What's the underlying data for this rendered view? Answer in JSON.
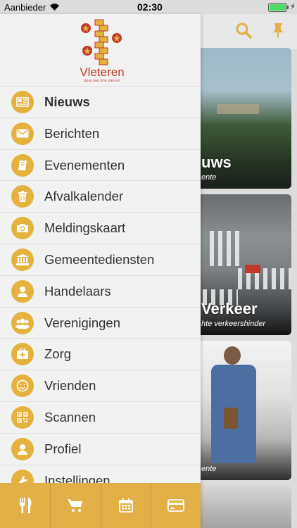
{
  "status_bar": {
    "carrier": "Aanbieder",
    "time": "02:30",
    "charge_symbol": "⚡"
  },
  "background": {
    "cards": [
      {
        "title": "uws",
        "subtitle": "ente"
      },
      {
        "title": "Verkeer",
        "subtitle": "hte verkeershinder"
      },
      {
        "title": "",
        "subtitle": "ente"
      }
    ]
  },
  "logo": {
    "wordmark": "Vleteren",
    "tagline": "dorp met drie sterren"
  },
  "menu": {
    "items": [
      {
        "label": "Nieuws",
        "icon": "newspaper-icon",
        "active": true
      },
      {
        "label": "Berichten",
        "icon": "envelope-icon"
      },
      {
        "label": "Evenementen",
        "icon": "book-icon"
      },
      {
        "label": "Afvalkalender",
        "icon": "trash-icon"
      },
      {
        "label": "Meldingskaart",
        "icon": "camera-icon"
      },
      {
        "label": "Gemeentediensten",
        "icon": "building-icon"
      },
      {
        "label": "Handelaars",
        "icon": "user-icon"
      },
      {
        "label": "Verenigingen",
        "icon": "group-icon"
      },
      {
        "label": "Zorg",
        "icon": "medkit-icon"
      },
      {
        "label": "Vrienden",
        "icon": "smiley-icon"
      },
      {
        "label": "Scannen",
        "icon": "qr-code-icon"
      },
      {
        "label": "Profiel",
        "icon": "user-icon"
      },
      {
        "label": "Instellingen",
        "icon": "wrench-icon"
      }
    ]
  },
  "bottom_tabs": [
    {
      "icon": "fork-knife-icon"
    },
    {
      "icon": "cart-icon"
    },
    {
      "icon": "calendar-icon"
    },
    {
      "icon": "credit-card-icon"
    }
  ],
  "colors": {
    "accent": "#e5b23e",
    "bottom_bar": "#e2b046",
    "logo_red": "#c0392b"
  }
}
